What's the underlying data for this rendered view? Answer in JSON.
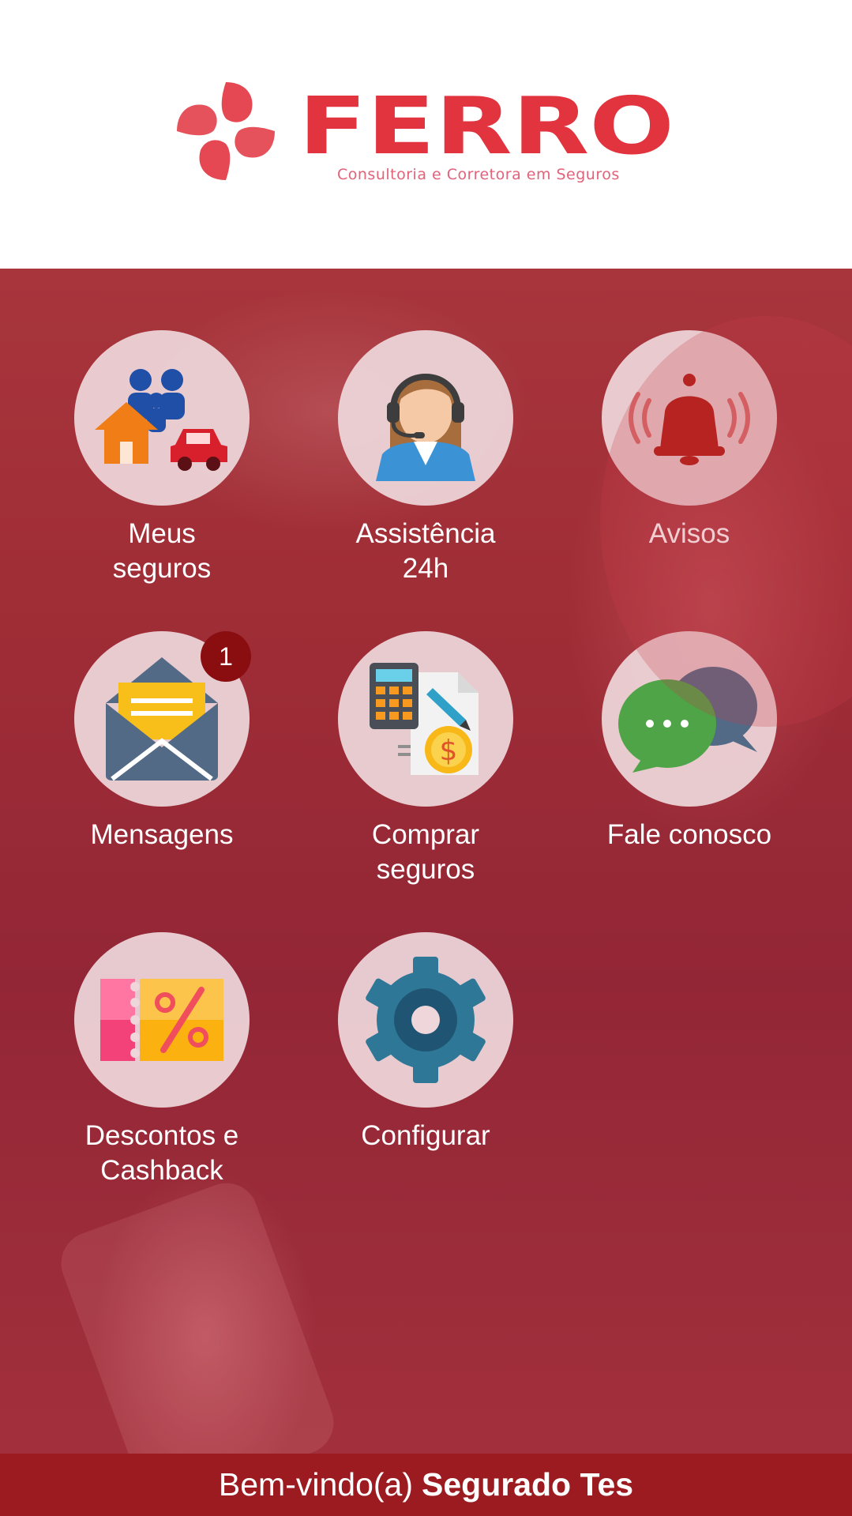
{
  "brand": {
    "name": "FERRO",
    "tagline": "Consultoria e Corretora em Seguros",
    "colors": {
      "primary": "#e2343f",
      "footer": "#9b1b20",
      "badge": "#8a0d0f"
    }
  },
  "menu": [
    {
      "label": "Meus\nseguros",
      "icon": "family-home-car-icon"
    },
    {
      "label": "Assistência\n24h",
      "icon": "headset-agent-icon"
    },
    {
      "label": "Avisos",
      "icon": "bell-icon"
    },
    {
      "label": "Mensagens",
      "icon": "envelope-icon",
      "badge": "1"
    },
    {
      "label": "Comprar\nseguros",
      "icon": "calculator-document-icon"
    },
    {
      "label": "Fale conosco",
      "icon": "chat-bubbles-icon"
    },
    {
      "label": "Descontos e\nCashback",
      "icon": "coupon-percent-icon"
    },
    {
      "label": "Configurar",
      "icon": "gear-icon"
    }
  ],
  "footer": {
    "greeting": "Bem-vindo(a)",
    "user_name": "Segurado Tes"
  }
}
